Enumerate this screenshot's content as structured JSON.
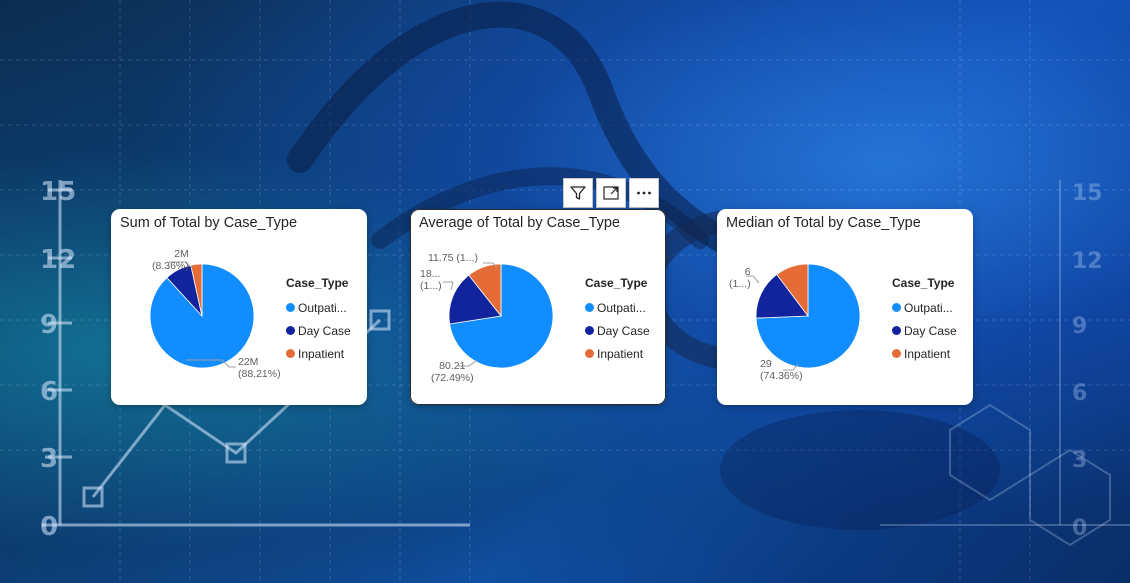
{
  "colors": {
    "outpatient": "#118DFF",
    "day_case": "#12239E",
    "inpatient": "#E66C37"
  },
  "visual_header": {
    "buttons": [
      "filter-icon",
      "focus-mode-icon",
      "more-options-icon"
    ]
  },
  "background": {
    "axis_ticks": [
      "15",
      "12",
      "9",
      "6",
      "3",
      "0"
    ]
  },
  "cards": [
    {
      "title": "Sum of Total by Case_Type",
      "legend_title": "Case_Type",
      "legend_items": [
        "Outpati...",
        "Day Case",
        "Inpatient"
      ],
      "labels": {
        "large_value": "22M",
        "large_pct": "(88.21%)",
        "small_value": "2M",
        "small_pct": "(8.36%)"
      }
    },
    {
      "title": "Average of Total by Case_Type",
      "legend_title": "Case_Type",
      "legend_items": [
        "Outpati...",
        "Day Case",
        "Inpatient"
      ],
      "labels": {
        "large_value": "80.21",
        "large_pct": "(72.49%)",
        "mid_value": "18...",
        "mid_pct": "(1...)",
        "small_combined": "11.75 (1...)"
      }
    },
    {
      "title": "Median of Total by Case_Type",
      "legend_title": "Case_Type",
      "legend_items": [
        "Outpati...",
        "Day Case",
        "Inpatient"
      ],
      "labels": {
        "large_value": "29",
        "large_pct": "(74.36%)",
        "small_value": "6",
        "small_pct": "(1...)"
      }
    }
  ],
  "chart_data": [
    {
      "type": "pie",
      "title": "Sum of Total by Case_Type",
      "legend_title": "Case_Type",
      "categories": [
        "Outpatient",
        "Day Case",
        "Inpatient"
      ],
      "values": [
        22000000,
        2085000,
        860000
      ],
      "percentages": [
        88.21,
        8.36,
        3.43
      ]
    },
    {
      "type": "pie",
      "title": "Average of Total by Case_Type",
      "legend_title": "Case_Type",
      "categories": [
        "Outpatient",
        "Day Case",
        "Inpatient"
      ],
      "values": [
        80.21,
        18.6,
        11.75
      ],
      "percentages": [
        72.49,
        16.89,
        10.62
      ]
    },
    {
      "type": "pie",
      "title": "Median of Total by Case_Type",
      "legend_title": "Case_Type",
      "categories": [
        "Outpatient",
        "Day Case",
        "Inpatient"
      ],
      "values": [
        29,
        6,
        4
      ],
      "percentages": [
        74.36,
        15.38,
        10.26
      ]
    }
  ]
}
